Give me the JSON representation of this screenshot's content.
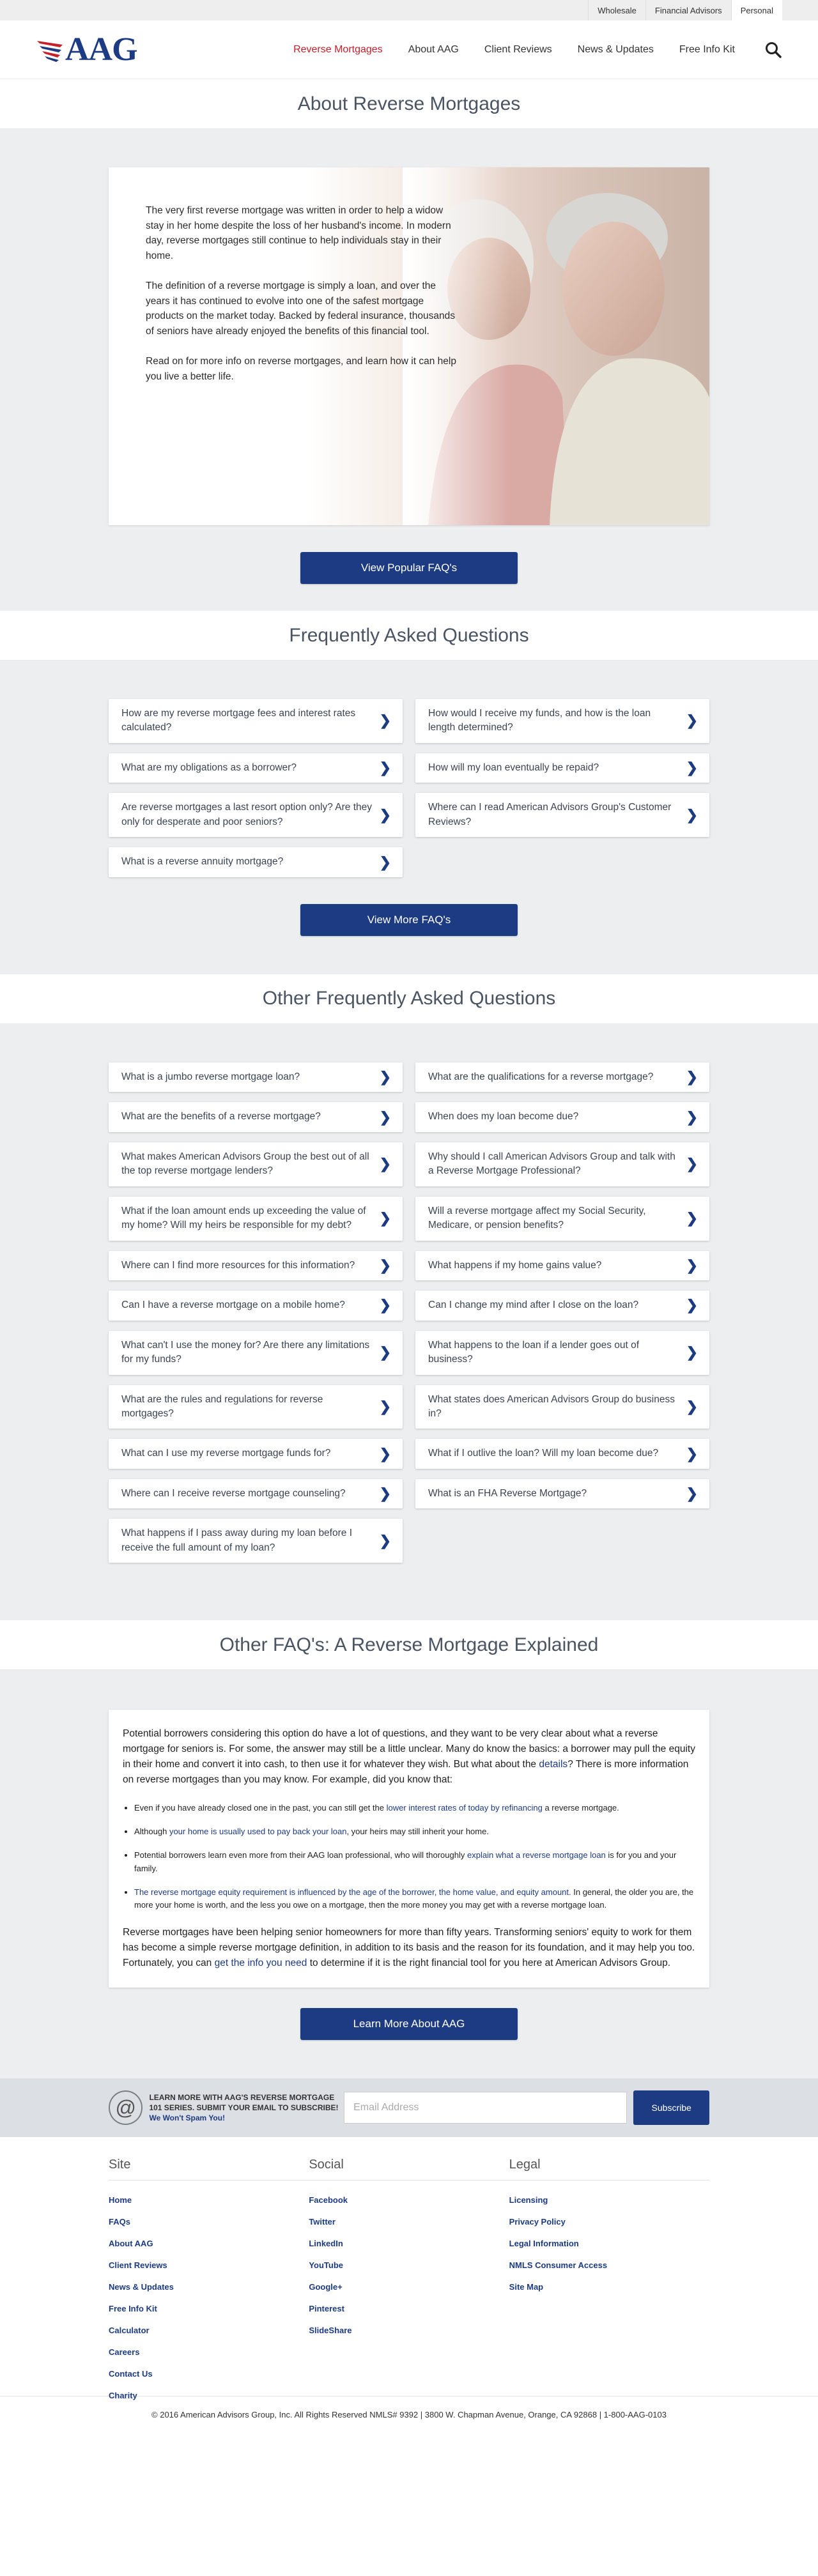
{
  "utility": {
    "links": [
      "Wholesale",
      "Financial Advisors",
      "Personal"
    ]
  },
  "header": {
    "logo": "AAG",
    "nav": [
      "Reverse Mortgages",
      "About AAG",
      "Client Reviews",
      "News & Updates",
      "Free Info Kit"
    ]
  },
  "about": {
    "title": "About Reverse Mortgages",
    "paragraphs": [
      "The very first reverse mortgage was written in order to help a widow stay in her home despite the loss of her husband's income. In modern day, reverse mortgages still continue to help individuals stay in their home.",
      "The definition of a reverse mortgage is simply a loan, and over the years it has continued to evolve into one of the safest mortgage products on the market today. Backed by federal insurance, thousands of seniors have already enjoyed the benefits of this financial tool.",
      "Read on for more info on reverse mortgages, and learn how it can help you live a better life."
    ],
    "button": "View Popular FAQ's"
  },
  "faq": {
    "title": "Frequently Asked Questions",
    "items": [
      "How are my reverse mortgage fees and interest rates calculated?",
      "How would I receive my funds, and how is the loan length determined?",
      "What are my obligations as a borrower?",
      "How will my loan eventually be repaid?",
      "Are reverse mortgages a last resort option only? Are they only for desperate and poor seniors?",
      "Where can I read American Advisors Group's Customer Reviews?",
      "What is a reverse annuity mortgage?"
    ],
    "button": "View More FAQ's"
  },
  "other_faq": {
    "title": "Other Frequently Asked Questions",
    "items": [
      "What is a jumbo reverse mortgage loan?",
      "What are the qualifications for a reverse mortgage?",
      "What are the benefits of a reverse mortgage?",
      "When does my loan become due?",
      "What makes American Advisors Group the best out of all the top reverse mortgage lenders?",
      "Why should I call American Advisors Group and talk with a Reverse Mortgage Professional?",
      "What if the loan amount ends up exceeding the value of my home? Will my heirs be responsible for my debt?",
      "Will a reverse mortgage affect my Social Security, Medicare, or pension benefits?",
      "Where can I find more resources for this information?",
      "What happens if my home gains value?",
      "Can I have a reverse mortgage on a mobile home?",
      "Can I change my mind after I close on the loan?",
      "What can't I use the money for? Are there any limitations for my funds?",
      "What happens to the loan if a lender goes out of business?",
      "What are the rules and regulations for reverse mortgages?",
      "What states does American Advisors Group do business in?",
      "What can I use my reverse mortgage funds for?",
      "What if I outlive the loan? Will my loan become due?",
      "Where can I receive reverse mortgage counseling?",
      "What is an FHA Reverse Mortgage?",
      "What happens if I pass away during my loan before I receive the full amount of my loan?"
    ]
  },
  "explained": {
    "title": "Other FAQ's: A Reverse Mortgage Explained",
    "intro_pre": "Potential borrowers considering this option do have a lot of questions, and they want to be very clear about what a reverse mortgage for seniors is. For some, the answer may still be a little unclear. Many do know the basics: a borrower may pull the equity in their home and convert it into cash, to then use it for whatever they wish. But what about the ",
    "intro_link": "details",
    "intro_post": "? There is more information on reverse mortgages than you may know. For example, did you know that:",
    "b1_pre": "Even if you have already closed one in the past, you can still get the ",
    "b1_link": "lower interest rates of today by refinancing",
    "b1_post": " a reverse mortgage.",
    "b2_pre": "Although ",
    "b2_link": "your home is usually used to pay back your loan",
    "b2_post": ", your heirs may still inherit your home.",
    "b3_pre": "Potential borrowers learn even more from their AAG loan professional, who will thoroughly ",
    "b3_link": "explain what a reverse mortgage loan",
    "b3_post": " is for you and your family.",
    "b4_link": "The reverse mortgage equity requirement is influenced by the age of the borrower, the home value, and equity amount.",
    "b4_post": " In general, the older you are, the more your home is worth, and the less you owe on a mortgage, then the more money you may get with a reverse mortgage loan.",
    "outro_pre": "Reverse mortgages have been helping senior homeowners for more than fifty years. Transforming seniors' equity to work for them has become a simple reverse mortgage definition, in addition to its basis and the reason for its foundation, and it may help you too. Fortunately, you can ",
    "outro_link": "get the info you need",
    "outro_post": " to determine if it is the right financial tool for you here at American Advisors Group.",
    "button": "Learn More About AAG"
  },
  "subscribe": {
    "text": "LEARN MORE WITH AAG'S REVERSE MORTGAGE 101 SERIES. SUBMIT YOUR EMAIL TO SUBSCRIBE!",
    "nospam": "We Won't Spam You!",
    "placeholder": "Email Address",
    "button": "Subscribe"
  },
  "footer": {
    "site": {
      "title": "Site",
      "links": [
        "Home",
        "FAQs",
        "About AAG",
        "Client Reviews",
        "News & Updates",
        "Free Info Kit",
        "Calculator",
        "Careers",
        "Contact Us",
        "Charity"
      ]
    },
    "social": {
      "title": "Social",
      "links": [
        "Facebook",
        "Twitter",
        "LinkedIn",
        "YouTube",
        "Google+",
        "Pinterest",
        "SlideShare"
      ]
    },
    "legal": {
      "title": "Legal",
      "links": [
        "Licensing",
        "Privacy Policy",
        "Legal Information",
        "NMLS Consumer Access",
        "Site Map"
      ]
    },
    "copyright": "© 2016 American Advisors Group, Inc. All Rights Reserved NMLS# 9392 | 3800 W. Chapman Avenue, Orange, CA 92868 | 1-800-AAG-0103"
  },
  "colors": {
    "brand": "#1d3b82",
    "accent": "#c6202a",
    "background": "#eceeef"
  }
}
